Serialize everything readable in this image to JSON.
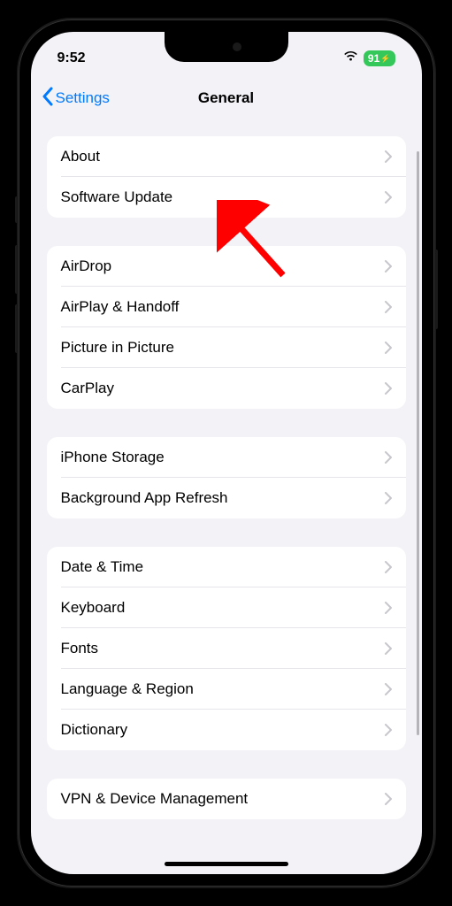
{
  "status": {
    "time": "9:52",
    "battery": "91"
  },
  "nav": {
    "back_label": "Settings",
    "title": "General"
  },
  "sections": [
    {
      "rows": [
        {
          "label": "About"
        },
        {
          "label": "Software Update"
        }
      ]
    },
    {
      "rows": [
        {
          "label": "AirDrop"
        },
        {
          "label": "AirPlay & Handoff"
        },
        {
          "label": "Picture in Picture"
        },
        {
          "label": "CarPlay"
        }
      ]
    },
    {
      "rows": [
        {
          "label": "iPhone Storage"
        },
        {
          "label": "Background App Refresh"
        }
      ]
    },
    {
      "rows": [
        {
          "label": "Date & Time"
        },
        {
          "label": "Keyboard"
        },
        {
          "label": "Fonts"
        },
        {
          "label": "Language & Region"
        },
        {
          "label": "Dictionary"
        }
      ]
    },
    {
      "rows": [
        {
          "label": "VPN & Device Management"
        }
      ]
    }
  ]
}
